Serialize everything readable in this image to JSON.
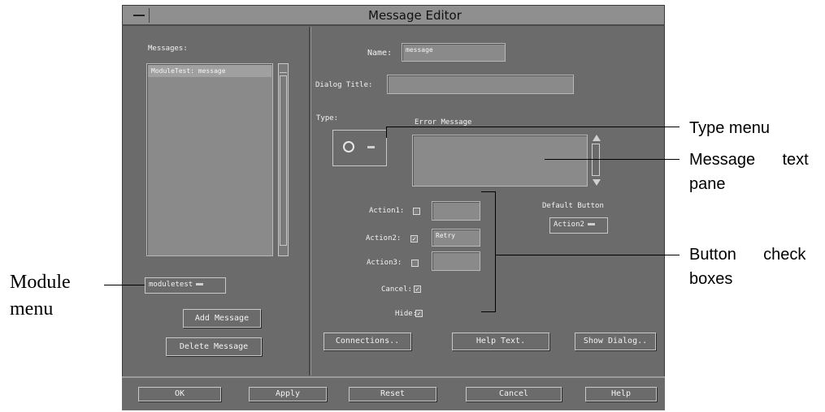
{
  "window": {
    "title": "Message Editor"
  },
  "left_panel": {
    "messages_label": "Messages:",
    "messages_list": [
      "ModuleTest: message"
    ],
    "module_menu_value": "moduletest",
    "add_message_label": "Add Message",
    "delete_message_label": "Delete Message"
  },
  "right_panel": {
    "name_label": "Name:",
    "name_value": "message",
    "dialog_title_label": "Dialog Title:",
    "dialog_title_value": "",
    "type_label": "Type:",
    "type_value_label": "Error Message",
    "message_text": "",
    "actions": [
      {
        "label": "Action1:",
        "checked": false,
        "value": ""
      },
      {
        "label": "Action2:",
        "checked": true,
        "value": "Retry"
      },
      {
        "label": "Action3:",
        "checked": false,
        "value": ""
      }
    ],
    "cancel_label": "Cancel:",
    "hide_label": "Hide:",
    "cancel_checked": true,
    "hide_checked": true,
    "default_button_label": "Default Button",
    "default_button_value": "Action2",
    "connections_label": "Connections..",
    "help_text_label": "Help Text.",
    "show_dialog_label": "Show Dialog.."
  },
  "bottom_bar": [
    "OK",
    "Apply",
    "Reset",
    "Cancel",
    "Help"
  ],
  "callouts": {
    "type_menu": "Type menu",
    "message_text_pane_line1": "Message      text",
    "message_text_pane_line2": "pane",
    "button_check_line1": "Button      check",
    "button_check_line2": "boxes",
    "module_menu_line1": "Module",
    "module_menu_line2": "menu"
  }
}
